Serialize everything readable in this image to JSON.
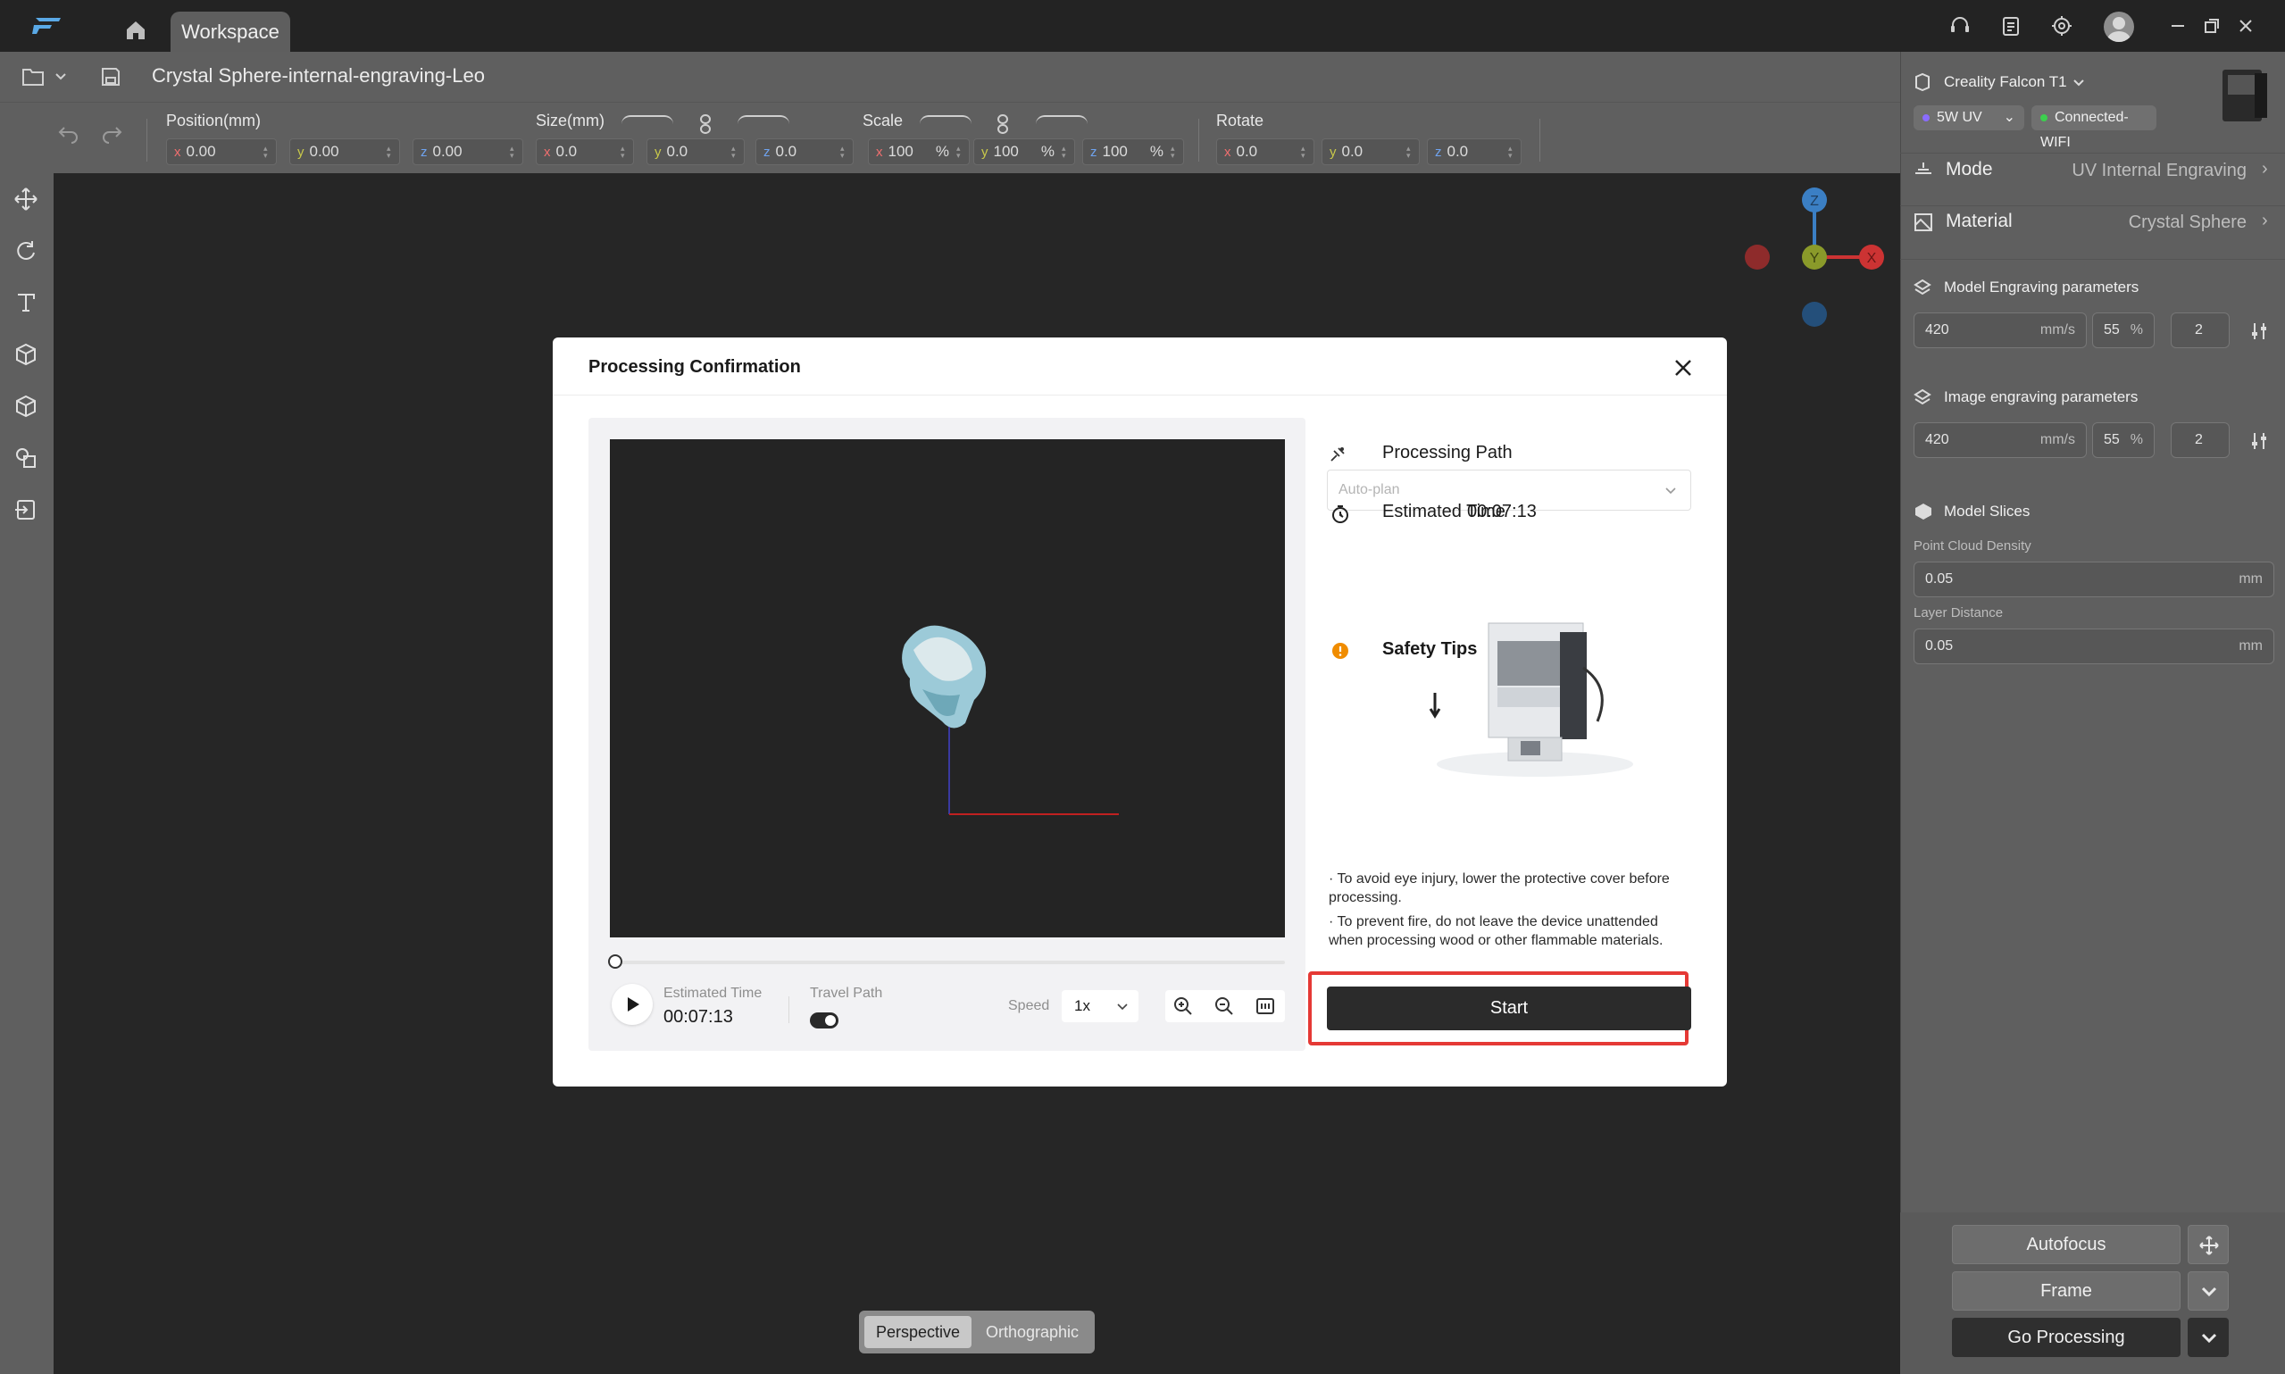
{
  "titlebar": {
    "tab_workspace": "Workspace"
  },
  "file": {
    "title": "Crystal Sphere-internal-engraving-Leo"
  },
  "toolbar": {
    "position_label": "Position(mm)",
    "size_label": "Size(mm)",
    "scale_label": "Scale",
    "rotate_label": "Rotate",
    "position": {
      "x": "0.00",
      "y": "0.00",
      "z": "0.00"
    },
    "size": {
      "x": "0.0",
      "y": "0.0",
      "z": "0.0"
    },
    "scale": {
      "x": "100",
      "y": "100",
      "z": "100",
      "unit": "%"
    },
    "rotate": {
      "x": "0.0",
      "y": "0.0",
      "z": "0.0"
    },
    "axis": {
      "x": "x",
      "y": "y",
      "z": "z"
    }
  },
  "view": {
    "perspective": "Perspective",
    "orthographic": "Orthographic"
  },
  "gizmo": {
    "x": "X",
    "y": "Y",
    "z": "Z"
  },
  "right_panel": {
    "device": "Creality Falcon T1",
    "laser": "5W UV",
    "connection": "Connected-WIFI",
    "mode_label": "Mode",
    "mode_value": "UV Internal Engraving",
    "material_label": "Material",
    "material_value": "Crystal Sphere",
    "model_params_label": "Model Engraving parameters",
    "model_params": {
      "speed": "420",
      "speed_unit": "mm/s",
      "power": "55",
      "power_unit": "%",
      "passes": "2"
    },
    "image_params_label": "Image engraving parameters",
    "image_params": {
      "speed": "420",
      "speed_unit": "mm/s",
      "power": "55",
      "power_unit": "%",
      "passes": "2"
    },
    "slices_label": "Model Slices",
    "point_density_label": "Point Cloud Density",
    "point_density_value": "0.05",
    "layer_distance_label": "Layer Distance",
    "layer_distance_value": "0.05",
    "unit_mm": "mm",
    "autofocus": "Autofocus",
    "frame": "Frame",
    "go_processing": "Go Processing"
  },
  "modal": {
    "title": "Processing Confirmation",
    "preview": {
      "estimated_time_label": "Estimated Time",
      "estimated_time_value": "00:07:13",
      "travel_path_label": "Travel Path",
      "travel_path_on": true,
      "speed_label": "Speed",
      "speed_value": "1x",
      "progress": 0
    },
    "processing_path_label": "Processing Path",
    "processing_path_placeholder": "Auto-plan",
    "estimated_time_label": "Estimated Time",
    "estimated_time_value": "00:07:13",
    "safety_title": "Safety Tips",
    "safety_tips": [
      "· To avoid eye injury, lower the protective cover before processing.",
      "· To prevent fire, do not leave the device unattended when processing wood or other flammable materials."
    ],
    "start_label": "Start"
  },
  "colors": {
    "accent_dark": "#2b2b2b",
    "highlight_red": "#e53935",
    "connected_green": "#3ccf4e",
    "uv_purple": "#8a6cff",
    "warning_orange": "#f08c00"
  }
}
